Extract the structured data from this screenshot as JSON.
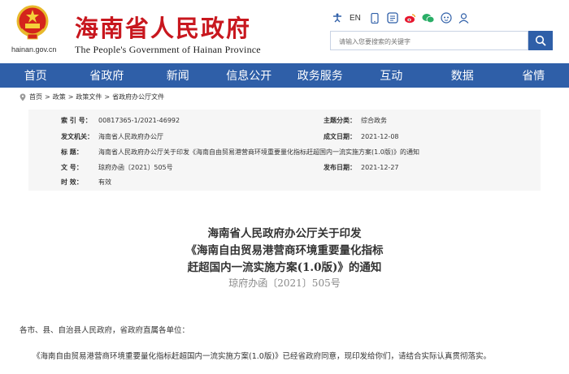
{
  "header": {
    "site_domain": "hainan.gov.cn",
    "site_title": "海南省人民政府",
    "site_subtitle": "The People's Government  of  Hainan Province",
    "top_links": [
      {
        "icon": "accessibility-icon",
        "label": ""
      },
      {
        "icon": "english-link",
        "label": "EN"
      },
      {
        "icon": "mobile-icon",
        "label": ""
      },
      {
        "icon": "government-app-icon",
        "label": ""
      },
      {
        "icon": "weibo-icon",
        "label": ""
      },
      {
        "icon": "wechat-icon",
        "label": ""
      },
      {
        "icon": "robot-icon",
        "label": ""
      },
      {
        "icon": "user-icon",
        "label": ""
      }
    ],
    "search_placeholder": "请输入您要搜索的关键字"
  },
  "nav": {
    "items": [
      "首页",
      "省政府",
      "新闻",
      "信息公开",
      "政务服务",
      "互动",
      "数据",
      "省情"
    ]
  },
  "breadcrumb": [
    "首页",
    "政策",
    "政策文件",
    "省政府办公厅文件"
  ],
  "info": {
    "index_label": "索   引   号：",
    "index_value": "00817365-1/2021-46992",
    "category_label": "主题分类：",
    "category_value": "综合政务",
    "issuer_label": "发文机关：",
    "issuer_value": "海南省人民政府办公厅",
    "date_label": "成文日期：",
    "date_value": "2021-12-08",
    "title_label": "标      题：",
    "title_value": "海南省人民政府办公厅关于印发《海南自由贸易港营商环境重要量化指标赶超国内一流实施方案(1.0版)》的通知",
    "docno_label": "文      号：",
    "docno_value": "琼府办函〔2021〕505号",
    "publish_label": "发布日期：",
    "publish_value": "2021-12-27",
    "validity_label": "时      效：",
    "validity_value": "有效"
  },
  "document": {
    "title_line1": "海南省人民政府办公厅关于印发",
    "title_line2": "《海南自由贸易港营商环境重要量化指标",
    "title_line3": "赶超国内一流实施方案(1.0版)》的通知",
    "number": "琼府办函〔2021〕505号",
    "salutation": "各市、县、自治县人民政府，省政府直属各单位：",
    "body1": "《海南自由贸易港营商环境重要量化指标赶超国内一流实施方案(1.0版)》已经省政府同意，现印发给你们，请结合实际认真贯彻落实。"
  },
  "colors": {
    "brand_red": "#c8171e",
    "nav_blue": "#2f5fa8",
    "info_bg": "#f6f6f6"
  }
}
